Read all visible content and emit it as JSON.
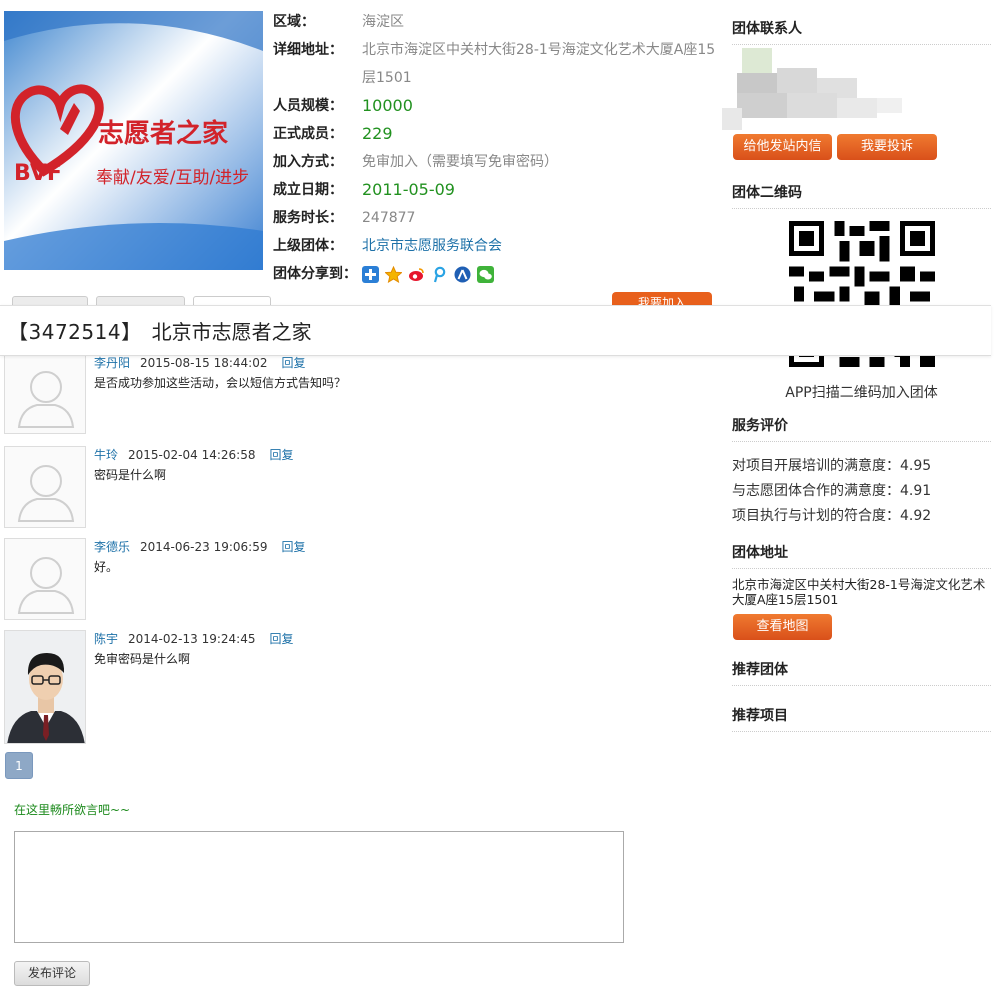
{
  "group": {
    "id": "【3472514】",
    "name": "北京市志愿者之家",
    "logo": {
      "brand_text": "志愿者之家",
      "abbr": "BVF",
      "slogan": "奉献/友爱/互助/进步"
    }
  },
  "info": {
    "region_label": "区域：",
    "region": "海淀区",
    "address_label": "详细地址：",
    "address_line1": "北京市海淀区中关村大街28-1号海淀文化艺术大厦A座15",
    "address_line2": "层1501",
    "size_label": "人员规模：",
    "size": "10000",
    "members_label": "正式成员：",
    "members": "229",
    "join_label": "加入方式：",
    "join": "免审加入（需要填写免审密码）",
    "founded_label": "成立日期：",
    "founded": "2011-05-09",
    "hours_label": "服务时长：",
    "hours": "247877",
    "parent_label": "上级团体：",
    "parent": "北京市志愿服务联合会",
    "share_label": "团体分享到：",
    "share_icons": [
      "plus-icon",
      "qzone-icon",
      "weibo-icon",
      "pengyou-icon",
      "renren-icon",
      "wechat-icon"
    ],
    "join_button": "我要加入"
  },
  "sidebar": {
    "contact_title": "团体联系人",
    "message_button": "给他发站内信",
    "complain_button": "我要投诉",
    "qr_title": "团体二维码",
    "qr_text": "APP扫描二维码加入团体",
    "rating_title": "服务评价",
    "ratings": [
      "对项目开展培训的满意度：4.95",
      "与志愿团体合作的满意度：4.91",
      "项目执行与计划的符合度：4.92"
    ],
    "address_title": "团体地址",
    "address": "北京市海淀区中关村大街28-1号海淀文化艺术大厦A座15层1501",
    "map_button": "查看地图",
    "rec_groups_title": "推荐团体",
    "rec_projects_title": "推荐项目"
  },
  "comments": [
    {
      "user": "李丹阳",
      "time": "2015-08-15 18:44:02",
      "reply": "回复",
      "text": "是否成功参加这些活动，会以短信方式告知吗？"
    },
    {
      "user": "牛玲",
      "time": "2015-02-04 14:26:58",
      "reply": "回复",
      "text": "密码是什么啊"
    },
    {
      "user": "李德乐",
      "time": "2014-06-23 19:06:59",
      "reply": "回复",
      "text": "好。"
    },
    {
      "user": "陈宇",
      "time": "2014-02-13 19:24:45",
      "reply": "回复",
      "text": "免审密码是什么啊"
    }
  ],
  "pagination": {
    "current": "1"
  },
  "comment_form": {
    "prompt": "在这里畅所欲言吧~~",
    "submit": "发布评论"
  },
  "colors": {
    "accent_orange": "#e8601c",
    "link_blue": "#1e71a8",
    "value_green": "#21911f",
    "logo_red": "#d2232a"
  }
}
